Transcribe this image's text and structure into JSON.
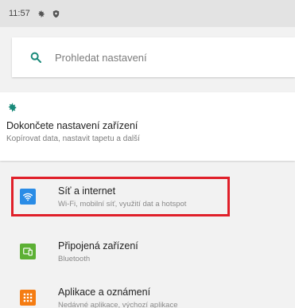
{
  "status_bar": {
    "time": "11:57"
  },
  "search": {
    "placeholder": "Prohledat nastavení"
  },
  "suggestion": {
    "title": "Dokončete nastavení zařízení",
    "subtitle": "Kopírovat data, nastavit tapetu a další"
  },
  "items": [
    {
      "title": "Síť a internet",
      "subtitle": "Wi-Fi, mobilní síť, využití dat a hotspot",
      "icon": "wifi-icon",
      "color": "#2a8ce6"
    },
    {
      "title": "Připojená zařízení",
      "subtitle": "Bluetooth",
      "icon": "connected-devices-icon",
      "color": "#5cb034"
    },
    {
      "title": "Aplikace a oznámení",
      "subtitle": "Nedávné aplikace, výchozí aplikace",
      "icon": "apps-icon",
      "color": "#f57c12"
    }
  ],
  "colors": {
    "accent": "#1a8a7a",
    "highlight": "#e0202a"
  }
}
